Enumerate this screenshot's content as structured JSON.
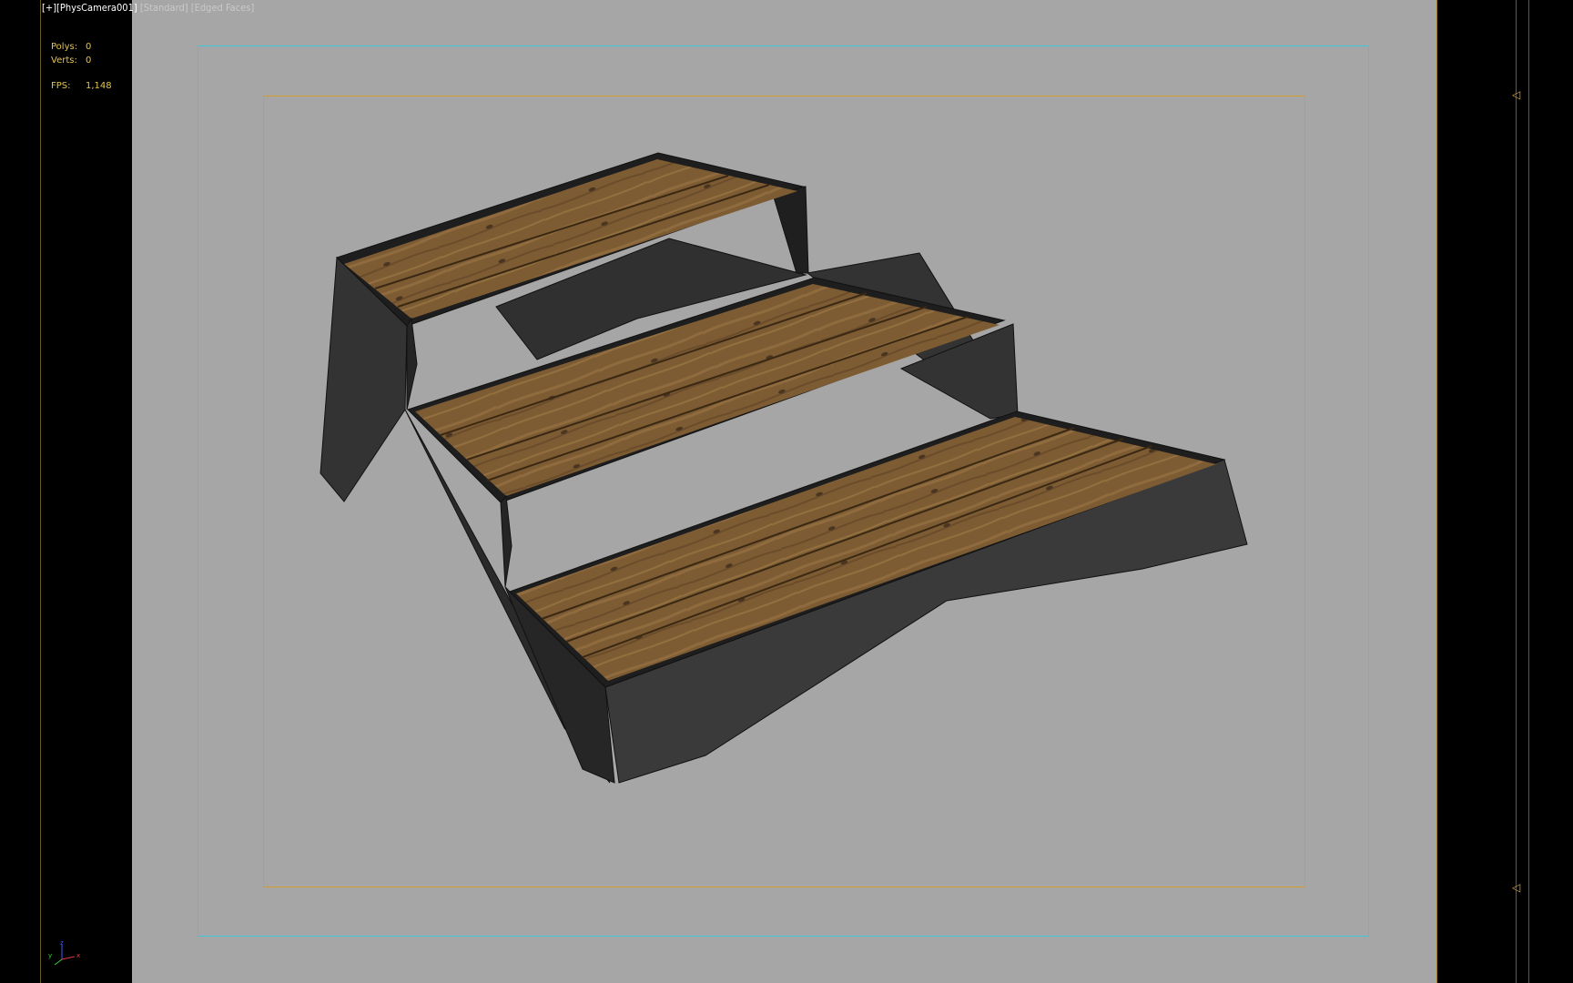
{
  "viewport": {
    "label_plus": "[+]",
    "label_camera": "[PhysCamera001]",
    "label_shading": "[Standard]",
    "label_mode": "[Edged Faces]"
  },
  "stats": {
    "polys_label": "Polys:",
    "polys_value": "0",
    "verts_label": "Verts:",
    "verts_value": "0",
    "fps_label": "FPS:",
    "fps_value": "1,148"
  },
  "axis": {
    "x": "x",
    "y": "y",
    "z": "z"
  },
  "markers": {
    "top": "◁",
    "bottom": "◁"
  },
  "colors": {
    "background": "#a6a6a6",
    "safe_frame": "#3fc6d8",
    "render_frame": "#d39d2b",
    "stats_text": "#e4c44a",
    "wood": "#7d5c34",
    "metal": "#2f2f2f"
  }
}
